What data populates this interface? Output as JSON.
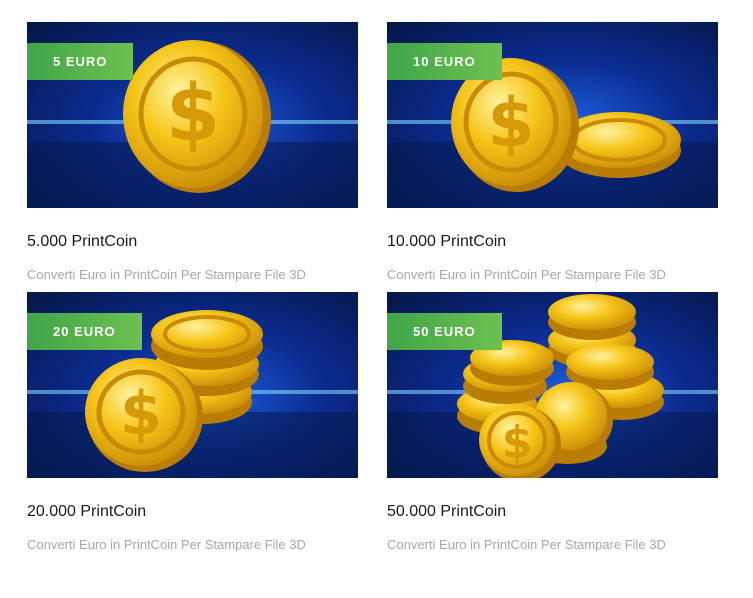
{
  "products": [
    {
      "badge": "5 EURO",
      "title": "5.000 PrintCoin",
      "description": "Converti Euro in PrintCoin Per Stampare File 3D",
      "image_icon": "single-gold-coin-icon"
    },
    {
      "badge": "10 EURO",
      "title": "10.000 PrintCoin",
      "description": "Converti Euro in PrintCoin Per Stampare File 3D",
      "image_icon": "two-gold-coins-icon"
    },
    {
      "badge": "20 EURO",
      "title": "20.000 PrintCoin",
      "description": "Converti Euro in PrintCoin Per Stampare File 3D",
      "image_icon": "coin-stack-icon"
    },
    {
      "badge": "50 EURO",
      "title": "50.000 PrintCoin",
      "description": "Converti Euro in PrintCoin Per Stampare File 3D",
      "image_icon": "coin-pile-icon"
    }
  ],
  "colors": {
    "badge_start": "#3fa64a",
    "badge_end": "#6ec04e",
    "coin_gold": "#f5c518",
    "coin_dark": "#c98a06",
    "background_blue": "#0b2b8f"
  }
}
